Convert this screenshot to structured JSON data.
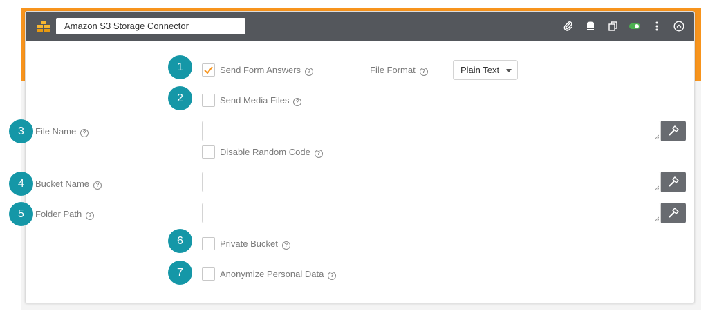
{
  "connector": {
    "title": "Amazon S3 Storage Connector",
    "logo_icon": "aws-s3-cubes-icon",
    "toggle_color": "#4caf50"
  },
  "header_icons": [
    "paperclip-icon",
    "database-icon",
    "copy-icon",
    "toggle-switch-icon",
    "kebab-menu-icon",
    "chevron-up-circle-icon"
  ],
  "colors": {
    "accent": "#f7941d",
    "badge": "#1597a7",
    "header": "#54575c",
    "check": "#f7941d"
  },
  "help_glyph": "?",
  "badges": [
    "1",
    "2",
    "3",
    "4",
    "5",
    "6",
    "7"
  ],
  "options": {
    "send_form_answers": {
      "label": "Send Form Answers",
      "checked": true
    },
    "send_media_files": {
      "label": "Send Media Files",
      "checked": false
    },
    "disable_random_code": {
      "label": "Disable Random Code",
      "checked": false
    },
    "private_bucket": {
      "label": "Private Bucket",
      "checked": false
    },
    "anonymize_personal_data": {
      "label": "Anonymize Personal Data",
      "checked": false
    }
  },
  "file_format": {
    "label": "File Format",
    "selected": "Plain Text"
  },
  "fields": {
    "file_name": {
      "label": "File Name",
      "value": ""
    },
    "bucket_name": {
      "label": "Bucket Name",
      "value": ""
    },
    "folder_path": {
      "label": "Folder Path",
      "value": ""
    }
  }
}
